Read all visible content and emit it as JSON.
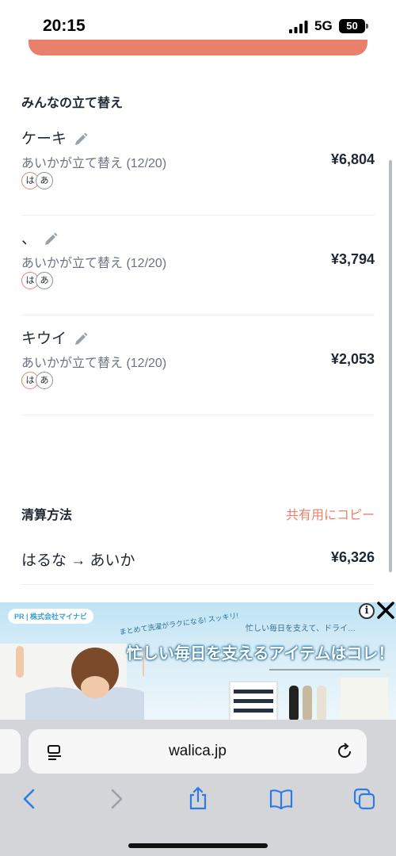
{
  "status_bar": {
    "time": "20:15",
    "network": "5G",
    "battery": "50"
  },
  "section_title": "みんなの立て替え",
  "entries": [
    {
      "name": "ケーキ",
      "subtitle": "あいかが立て替え (12/20)",
      "amount": "¥6,804",
      "avatars": [
        "は",
        "あ"
      ]
    },
    {
      "name": "、",
      "subtitle": "あいかが立て替え (12/20)",
      "amount": "¥3,794",
      "avatars": [
        "は",
        "あ"
      ]
    },
    {
      "name": "キウイ",
      "subtitle": "あいかが立て替え (12/20)",
      "amount": "¥2,053",
      "avatars": [
        "は",
        "あ"
      ]
    }
  ],
  "settlement": {
    "title": "清算方法",
    "copy_label": "共有用にコピー",
    "rows": [
      {
        "text": "はるな → あいか",
        "amount": "¥6,326"
      }
    ]
  },
  "ad": {
    "badge": "PR | 株式会社マイナビ",
    "sub_left": "まとめて洗濯がラクになる! スッキリ!",
    "sub_right": "忙しい毎日を支えて、ドライ…",
    "headline": "忙しい毎日を支えるアイテムはコレ！"
  },
  "browser": {
    "url": "walica.jp"
  },
  "colors": {
    "accent": "#e9806b",
    "text": "#1f2733",
    "muted": "#6b7280",
    "browser_bg": "#d3d5d9",
    "link_blue": "#2f7ae5"
  }
}
